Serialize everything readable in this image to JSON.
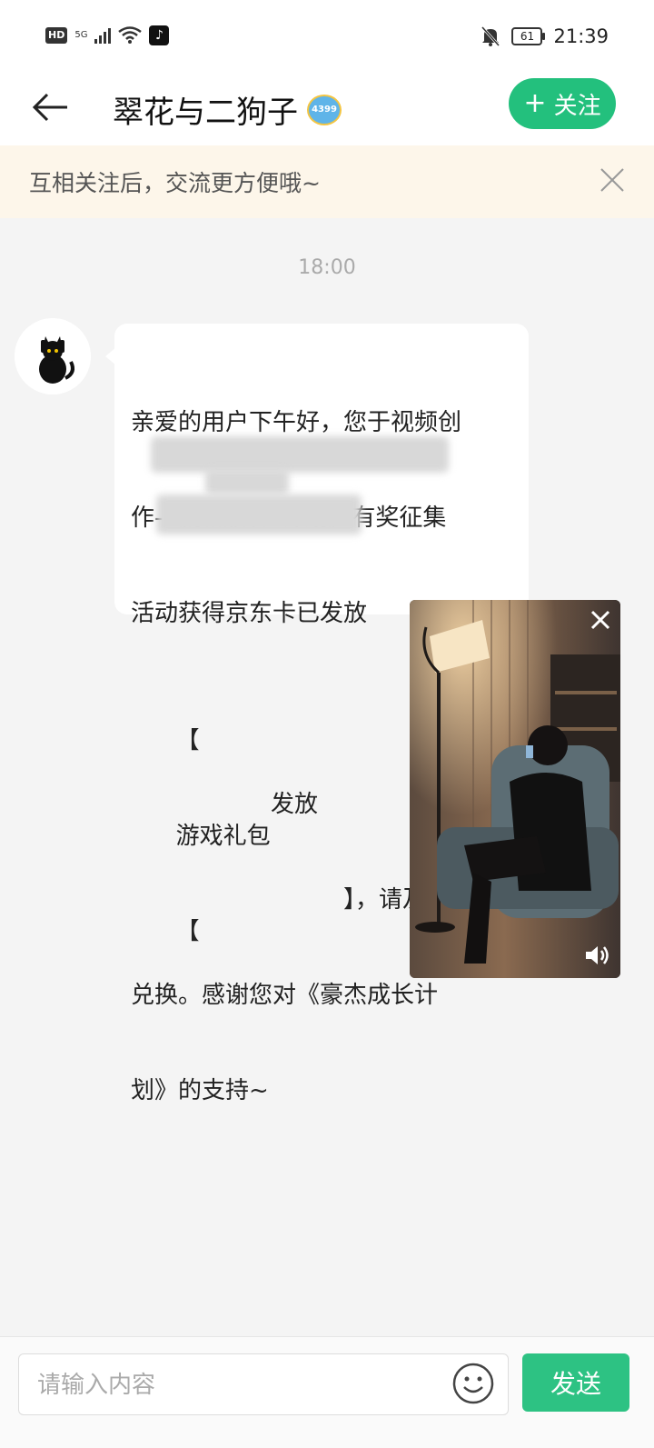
{
  "status_bar": {
    "hd": "HD",
    "signal": "5G",
    "time": "21:39",
    "battery": "61"
  },
  "header": {
    "title": "翠花与二狗子",
    "badge": "4399",
    "follow_label": "关注"
  },
  "notice": {
    "text": "互相关注后，交流更方便哦~"
  },
  "chat": {
    "timestamp": "18:00",
    "message_lines": [
      "亲爱的用户下午好，您于视频创",
      "作-《豪杰成长计划》有奖征集",
      "活动获得京东卡已发放",
      "【",
      "游戏礼包",
      "发放",
      "【",
      "】，请及时",
      "兑换。感谢您对《豪杰成长计",
      "划》的支持~"
    ]
  },
  "input": {
    "placeholder": "请输入内容",
    "send_label": "发送"
  }
}
